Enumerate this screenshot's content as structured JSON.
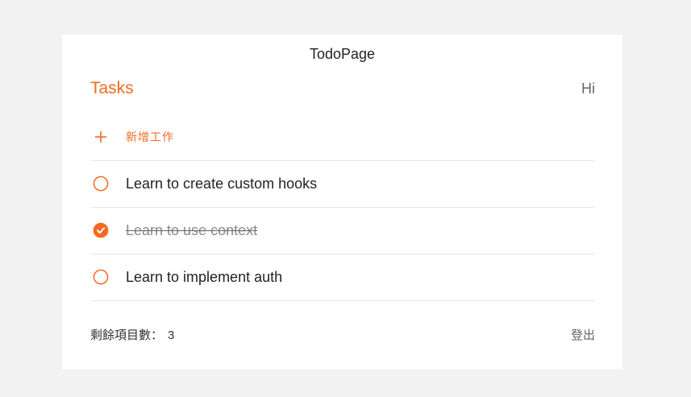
{
  "page": {
    "title": "TodoPage"
  },
  "header": {
    "tasks_title": "Tasks",
    "greeting": "Hi"
  },
  "add_task": {
    "label": "新增工作",
    "icon": "plus-icon"
  },
  "tasks": [
    {
      "text": "Learn to create custom hooks",
      "done": false
    },
    {
      "text": "Learn to use context",
      "done": true
    },
    {
      "text": "Learn to implement auth",
      "done": false
    }
  ],
  "footer": {
    "remaining_label": "剩餘項目數：",
    "remaining_count": "3",
    "logout_label": "登出"
  },
  "colors": {
    "accent": "#f26b21",
    "background": "#f2f2f2",
    "card": "#ffffff"
  }
}
